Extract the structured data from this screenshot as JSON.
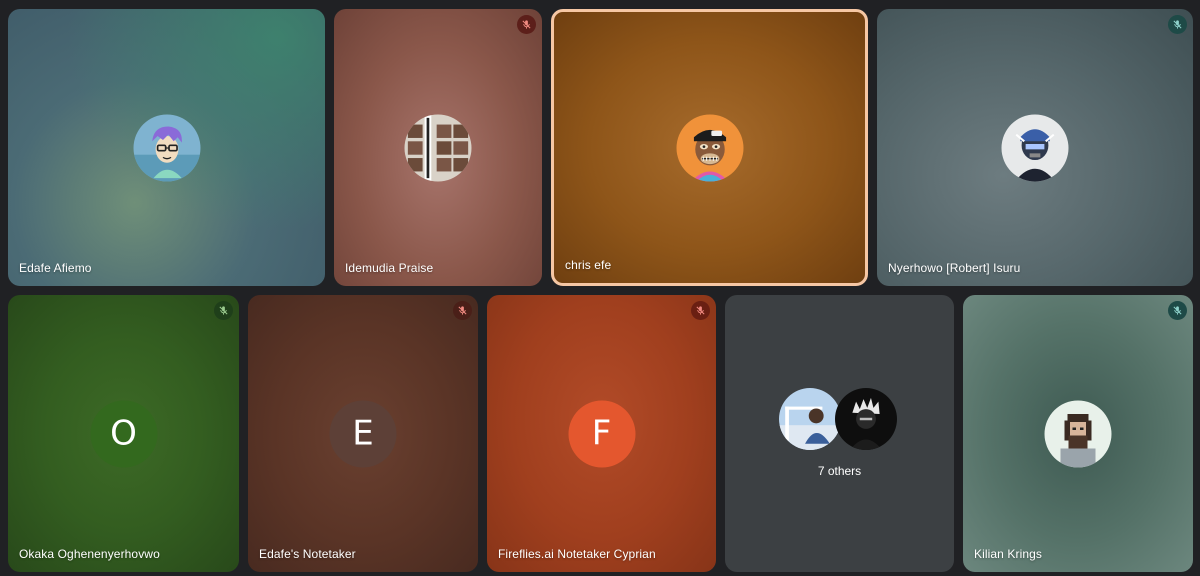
{
  "participants": [
    {
      "name": "Edafe Afiemo",
      "avatar": "cartoon-avatar-glasses-icon"
    },
    {
      "name": "Idemudia Praise",
      "avatar": "photo-collage-avatar",
      "muted": true
    },
    {
      "name": "chris efe",
      "avatar": "bored-ape-avatar",
      "speaking": true
    },
    {
      "name": "Nyerhowo [Robert] Isuru",
      "avatar": "robot-avatar",
      "muted": true
    },
    {
      "name": "Okaka Oghenenyerhovwo",
      "initial": "O",
      "muted": true
    },
    {
      "name": "Edafe's Notetaker",
      "initial": "E",
      "muted": true
    },
    {
      "name": "Fireflies.ai Notetaker Cyprian",
      "initial": "F",
      "muted": true
    },
    {
      "others_label": "7 others"
    },
    {
      "name": "Kilian Krings",
      "avatar": "pixel-art-avatar",
      "muted": true
    }
  ],
  "colors": {
    "background": "#202124",
    "speaking_border": "#f6c7a4",
    "mic_off_red": "#5c1f1a",
    "mic_off_teal": "#1e4a47",
    "initial_F": "#e4572e",
    "initial_E": "#5d4037",
    "initial_O": "#33691e"
  }
}
